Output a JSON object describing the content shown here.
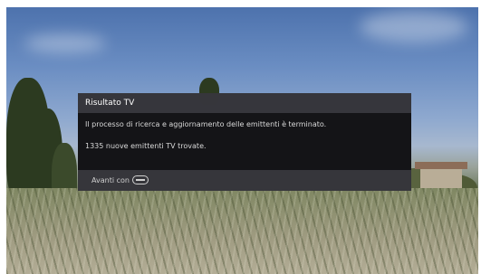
{
  "dialog": {
    "title": "Risultato TV",
    "message_line1": "Il processo di ricerca e aggiornamento delle emittenti è terminato.",
    "message_line2": "1335 nuove emittenti TV trovate.",
    "footer_label": "Avanti con",
    "footer_key_icon": "ok-button-icon"
  },
  "colors": {
    "dialog_background": "#28282c",
    "dialog_body": "#141417",
    "text": "#e8e8e8"
  }
}
